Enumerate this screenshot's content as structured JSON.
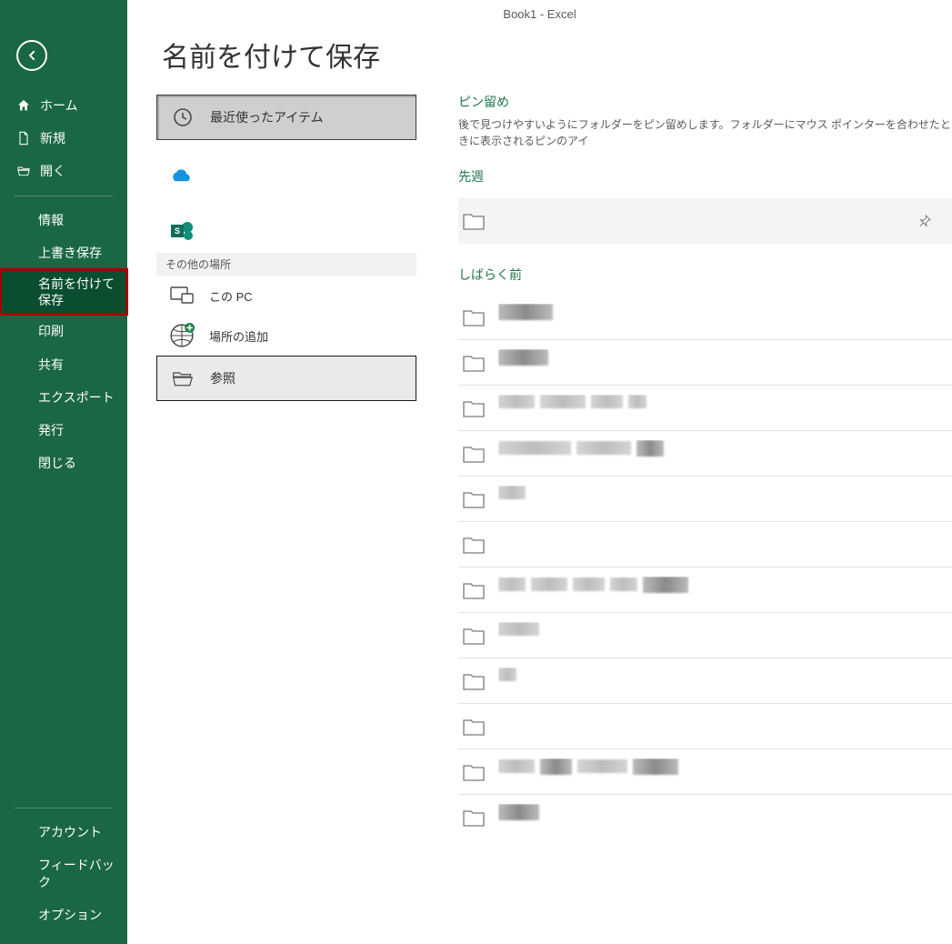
{
  "window_title": "Book1  -  Excel",
  "page_heading": "名前を付けて保存",
  "sidebar": {
    "back": "←",
    "top": [
      {
        "label": "ホーム",
        "icon": "home"
      },
      {
        "label": "新規",
        "icon": "file"
      },
      {
        "label": "開く",
        "icon": "open"
      }
    ],
    "mid": [
      {
        "label": "情報"
      },
      {
        "label": "上書き保存"
      },
      {
        "label": "名前を付けて保存",
        "active": true
      },
      {
        "label": "印刷"
      },
      {
        "label": "共有"
      },
      {
        "label": "エクスポート"
      },
      {
        "label": "発行"
      },
      {
        "label": "閉じる"
      }
    ],
    "bottom": [
      {
        "label": "アカウント"
      },
      {
        "label": "フィードバック"
      },
      {
        "label": "オプション"
      }
    ]
  },
  "locations": {
    "recent": "最近使ったアイテム",
    "other_header": "その他の場所",
    "this_pc": "この PC",
    "add_place": "場所の追加",
    "browse": "参照"
  },
  "right": {
    "pinned_title": "ピン留め",
    "pinned_desc": "後で見つけやすいようにフォルダーをピン留めします。フォルダーにマウス ポインターを合わせたときに表示されるピンのアイ",
    "last_week": "先週",
    "while_ago": "しばらく前"
  }
}
